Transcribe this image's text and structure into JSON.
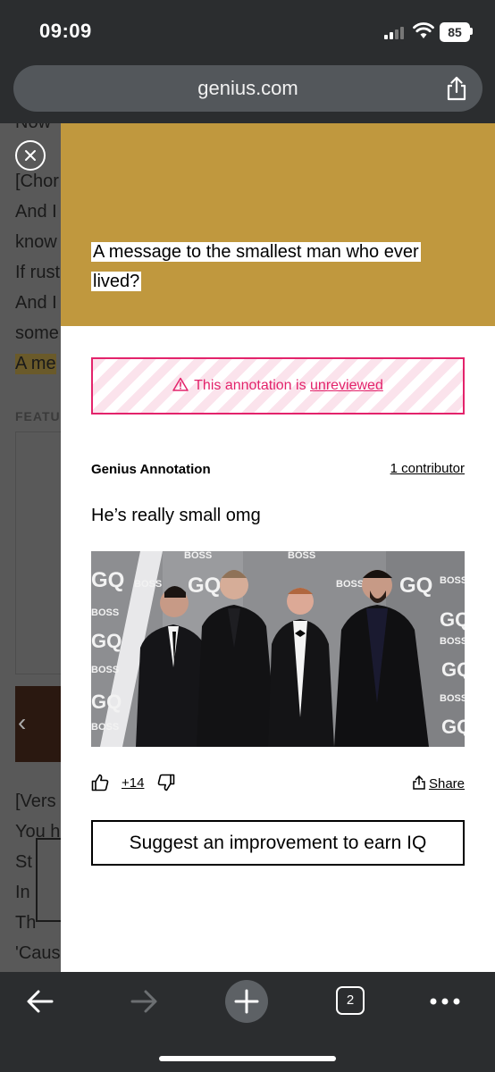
{
  "status_bar": {
    "time": "09:09",
    "battery": "85"
  },
  "browser": {
    "url": "genius.com",
    "tab_count": "2"
  },
  "background_page": {
    "lines": [
      "Now",
      "[Chor",
      "And I",
      "know",
      "If rust",
      "And I",
      "some",
      "A me"
    ],
    "feature_label": "FEATU",
    "bottom_lines": [
      "[Vers",
      "You h",
      "St",
      "In",
      "Th",
      "'Caus"
    ]
  },
  "annotation": {
    "quote": "A message to the smallest man who ever lived?",
    "unreviewed_prefix": "This annotation is ",
    "unreviewed_link": "unreviewed",
    "label": "Genius Annotation",
    "contributors": "1 contributor",
    "body": "He’s really small omg",
    "photo_text": {
      "gq": "GQ",
      "boss": "BOSS"
    },
    "votes": "+14",
    "share_label": "Share",
    "suggest_label": "Suggest an improvement to earn IQ"
  },
  "colors": {
    "header": "#c0983e",
    "warning": "#e3236b",
    "chrome": "#2b2d2f"
  }
}
